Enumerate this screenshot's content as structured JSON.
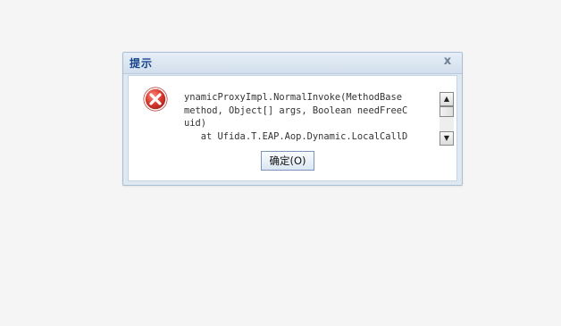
{
  "dialog": {
    "title": "提示",
    "close_label": "x",
    "icon": "error-icon",
    "message_lines": [
      "ynamicProxyImpl.NormalInvoke(MethodBase",
      "method, Object[] args, Boolean needFreeC",
      "uid)",
      "   at Ufida.T.EAP.Aop.Dynamic.LocalCallD"
    ],
    "ok_label": "确定(O)"
  },
  "colors": {
    "title_text": "#15428b",
    "error_red": "#d9392f"
  }
}
